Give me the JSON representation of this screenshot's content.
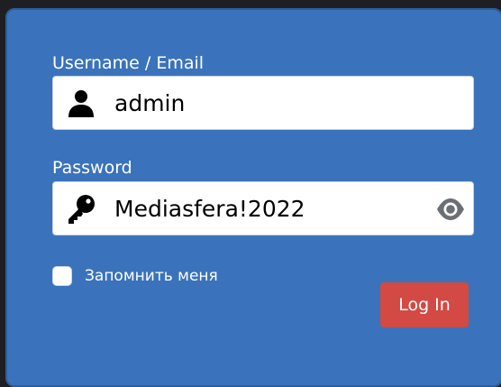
{
  "form": {
    "username_label": "Username / Email",
    "username_value": "admin",
    "password_label": "Password",
    "password_value": "Mediasfera!2022",
    "remember_label": "Запомнить меня",
    "remember_checked": false,
    "login_label": "Log In"
  },
  "icons": {
    "username": "user-icon",
    "password": "key-icon",
    "toggle": "eye-icon"
  },
  "colors": {
    "panel_background": "#3a73bb",
    "page_background": "#1e1f22",
    "button_background": "#d24a43",
    "text_light": "#ffffff"
  }
}
